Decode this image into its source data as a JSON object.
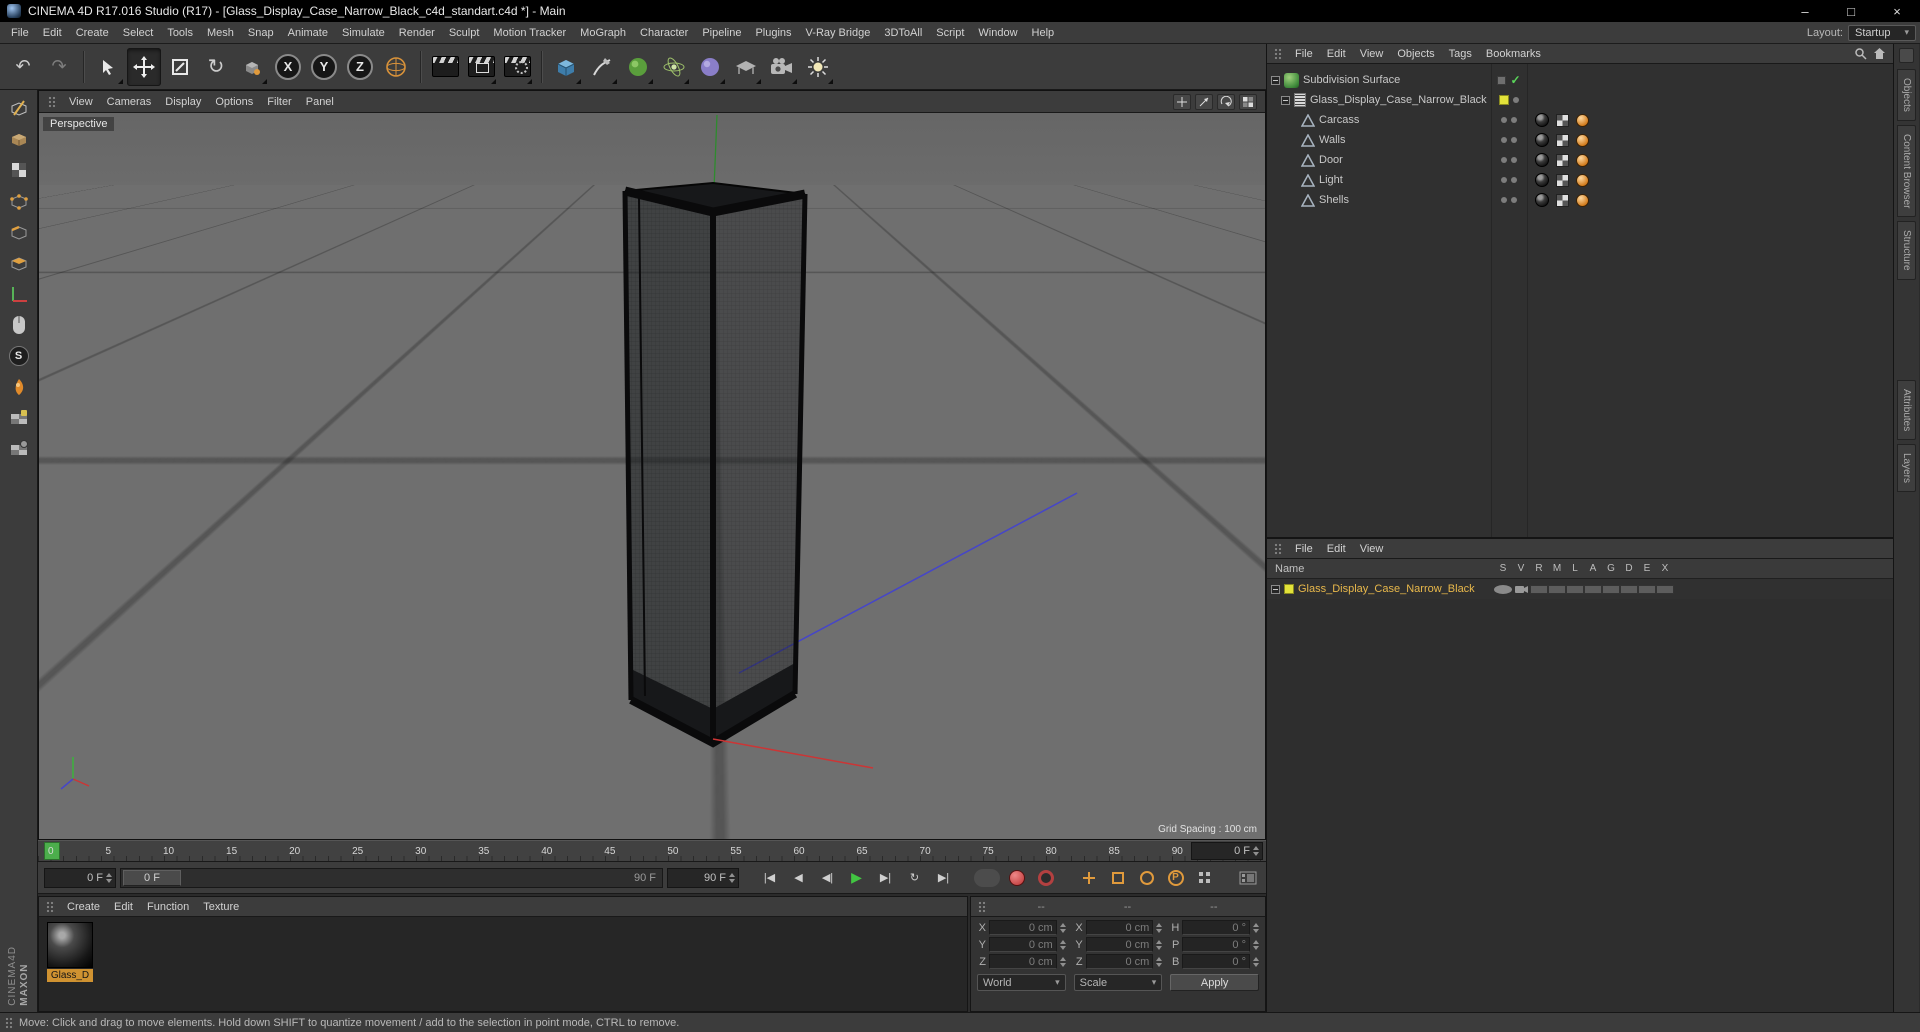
{
  "title_bar": {
    "title": "CINEMA 4D R17.016 Studio (R17) - [Glass_Display_Case_Narrow_Black_c4d_standart.c4d *] - Main"
  },
  "window": {
    "minimize": "–",
    "maximize": "□",
    "close": "×"
  },
  "menu_bar": {
    "items": [
      "File",
      "Edit",
      "Create",
      "Select",
      "Tools",
      "Mesh",
      "Snap",
      "Animate",
      "Simulate",
      "Render",
      "Sculpt",
      "Motion Tracker",
      "MoGraph",
      "Character",
      "Pipeline",
      "Plugins",
      "V-Ray Bridge",
      "3DToAll",
      "Script",
      "Window",
      "Help"
    ],
    "layout_label": "Layout:",
    "layout_value": "Startup"
  },
  "icons": {
    "undo": "↶",
    "redo": "↷",
    "rotate": "↻",
    "check": "✓",
    "caret": "▾",
    "param": "P",
    "snap": "S"
  },
  "toolbar": {
    "axis": [
      "X",
      "Y",
      "Z"
    ]
  },
  "viewport": {
    "menus": [
      "View",
      "Cameras",
      "Display",
      "Options",
      "Filter",
      "Panel"
    ],
    "label": "Perspective",
    "grid_spacing": "Grid Spacing : 100 cm"
  },
  "object_manager": {
    "menus": [
      "File",
      "Edit",
      "View",
      "Objects",
      "Tags",
      "Bookmarks"
    ],
    "items": [
      {
        "label": "Subdivision Surface"
      },
      {
        "label": "Glass_Display_Case_Narrow_Black"
      },
      {
        "label": "Carcass"
      },
      {
        "label": "Walls"
      },
      {
        "label": "Door"
      },
      {
        "label": "Light"
      },
      {
        "label": "Shells"
      }
    ]
  },
  "layer_manager": {
    "menus": [
      "File",
      "Edit",
      "View"
    ],
    "name_header": "Name",
    "columns": [
      "S",
      "V",
      "R",
      "M",
      "L",
      "A",
      "G",
      "D",
      "E",
      "X"
    ],
    "layer_name": "Glass_Display_Case_Narrow_Black"
  },
  "timeline": {
    "ticks": [
      "0",
      "5",
      "10",
      "15",
      "20",
      "25",
      "30",
      "35",
      "40",
      "45",
      "50",
      "55",
      "60",
      "65",
      "70",
      "75",
      "80",
      "85",
      "90"
    ],
    "frame_box": "0 F"
  },
  "transport": {
    "current_frame": "0 F",
    "marker": "0 F",
    "range_end": "90 F",
    "end_frame": "90 F",
    "buttons": [
      "|◀",
      "◀",
      "◀|",
      "▶",
      "▶|",
      "↻",
      "▶|"
    ]
  },
  "material_manager": {
    "menus": [
      "Create",
      "Edit",
      "Function",
      "Texture"
    ],
    "material_label": "Glass_D"
  },
  "coordinates": {
    "headers": [
      "--",
      "--",
      "--"
    ],
    "position": {
      "labels": [
        "X",
        "Y",
        "Z"
      ],
      "values": [
        "0 cm",
        "0 cm",
        "0 cm"
      ]
    },
    "size": {
      "labels": [
        "X",
        "Y",
        "Z"
      ],
      "values": [
        "0 cm",
        "0 cm",
        "0 cm"
      ]
    },
    "rotation": {
      "labels": [
        "H",
        "P",
        "B"
      ],
      "values": [
        "0 °",
        "0 °",
        "0 °"
      ]
    },
    "world": "World",
    "scale": "Scale",
    "apply": "Apply"
  },
  "side_tabs": {
    "upper": [
      "Objects",
      "Content Browser",
      "Structure"
    ],
    "lower": [
      "Attributes",
      "Layers"
    ]
  },
  "status_bar": {
    "text": "Move: Click and drag to move elements. Hold down SHIFT to quantize movement / add to the selection in point mode, CTRL to remove."
  },
  "branding": {
    "maxon": "MAXON",
    "cinema": "CINEMA4D"
  }
}
